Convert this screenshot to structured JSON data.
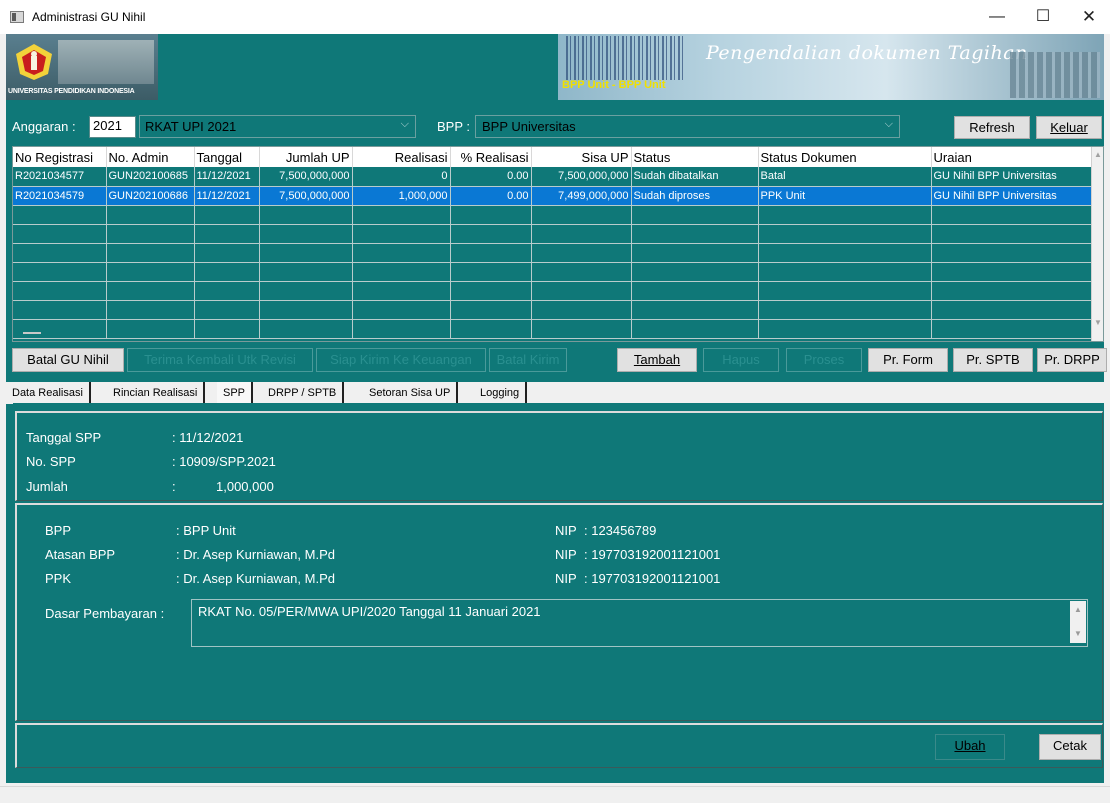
{
  "window": {
    "title": "Administrasi GU Nihil",
    "minimize": "—",
    "maximize": "☐",
    "close": "✕"
  },
  "banner": {
    "university": "UNIVERSITAS PENDIDIKAN INDONESIA",
    "bpp_label": "BPP Unit - BPP Unit",
    "title": "Pengendalian dokumen Tagihan"
  },
  "filter": {
    "anggaran_label": "Anggaran :",
    "anggaran_value": "2021",
    "rkat_value": "RKAT UPI 2021",
    "bpp_label": "BPP :",
    "bpp_value": "BPP Universitas",
    "refresh": "Refresh",
    "keluar": "Keluar"
  },
  "grid": {
    "columns": [
      "No Registrasi",
      "No. Admin",
      "Tanggal",
      "Jumlah UP",
      "Realisasi",
      "% Realisasi",
      "Sisa UP",
      "Status",
      "Status Dokumen",
      "Uraian"
    ],
    "rows": [
      [
        "R2021034577",
        "GUN202100685",
        "11/12/2021",
        "7,500,000,000",
        "0",
        "0.00",
        "7,500,000,000",
        "Sudah dibatalkan",
        "Batal",
        "GU Nihil BPP Universitas"
      ],
      [
        "R2021034579",
        "GUN202100686",
        "11/12/2021",
        "7,500,000,000",
        "1,000,000",
        "0.00",
        "7,499,000,000",
        "Sudah diproses",
        "PPK Unit",
        "GU Nihil BPP Universitas"
      ]
    ],
    "selected_row": 1
  },
  "actions": {
    "batal_gu_nihil": "Batal GU Nihil",
    "terima_kembali": "Terima Kembali Utk Revisi",
    "siap_kirim": "Siap Kirim Ke Keuangan",
    "batal_kirim": "Batal Kirim",
    "tambah": "Tambah",
    "hapus": "Hapus",
    "proses": "Proses",
    "pr_form": "Pr. Form",
    "pr_sptb": "Pr. SPTB",
    "pr_drpp": "Pr. DRPP"
  },
  "tabs": [
    "Data Realisasi",
    "Rincian Realisasi",
    "SPP",
    "DRPP / SPTB",
    "Setoran Sisa UP",
    "Logging"
  ],
  "active_tab": "SPP",
  "spp": {
    "tanggal_label": "Tanggal SPP",
    "tanggal_value": ": 11/12/2021",
    "no_label": "No. SPP",
    "no_value": ": 10909/SPP.2021",
    "jumlah_label": "Jumlah",
    "jumlah_colon": ":",
    "jumlah_value": "1,000,000"
  },
  "pejabat": {
    "bpp_label": "BPP",
    "bpp_value": ": BPP Unit",
    "bpp_nip_label": "NIP",
    "bpp_nip": ": 123456789",
    "atasan_label": "Atasan BPP",
    "atasan_value": ": Dr. Asep Kurniawan, M.Pd",
    "atasan_nip_label": "NIP",
    "atasan_nip": ": 197703192001121001",
    "ppk_label": "PPK",
    "ppk_value": ": Dr. Asep Kurniawan, M.Pd",
    "ppk_nip_label": "NIP",
    "ppk_nip": ": 197703192001121001",
    "dasar_label": "Dasar Pembayaran :",
    "dasar_value": "RKAT No. 05/PER/MWA UPI/2020 Tanggal 11 Januari 2021"
  },
  "footer": {
    "ubah": "Ubah",
    "cetak": "Cetak"
  }
}
